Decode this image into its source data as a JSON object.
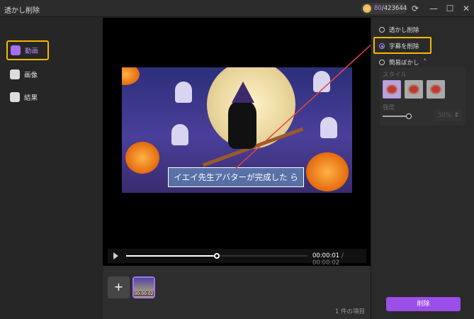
{
  "titlebar": {
    "title": "透かし削除",
    "credits_used": "80",
    "credits_total": "/423644"
  },
  "sidebar": {
    "items": [
      {
        "label": "動画"
      },
      {
        "label": "画像"
      },
      {
        "label": "結果"
      }
    ]
  },
  "preview": {
    "subtitle": "イエイ先生アバターが完成した ら",
    "current_time": "00:00:01",
    "total_time": " / 00:00:02",
    "progress": 0.5
  },
  "bottom": {
    "add_label": "+",
    "clip_duration": "00:00:02",
    "item_count": "1 件の項目"
  },
  "panel": {
    "options": [
      "透かし削除",
      "字幕を削除",
      "簡易ぼかし"
    ],
    "selected": "字幕を削除",
    "expand_icon": "˄",
    "style_label": "スタイル",
    "strength_label": "強度",
    "strength_value": "50%",
    "delete_label": "削除"
  },
  "colors": {
    "accent": "#9b4fe8",
    "highlight": "#f5b800"
  }
}
